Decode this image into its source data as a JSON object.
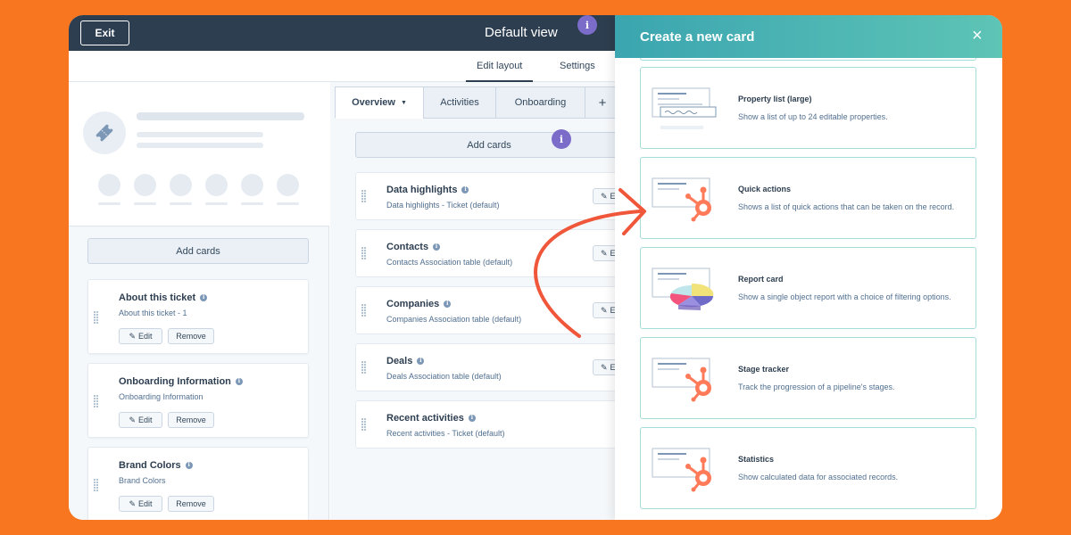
{
  "topbar": {
    "exit_label": "Exit",
    "title": "Default view",
    "info_glyph": "i"
  },
  "subtabs": {
    "edit_layout": "Edit layout",
    "settings": "Settings"
  },
  "left": {
    "add_cards_label": "Add cards",
    "cards": [
      {
        "title": "About this ticket",
        "subtitle": "About this ticket - 1",
        "edit": "Edit",
        "remove": "Remove"
      },
      {
        "title": "Onboarding Information",
        "subtitle": "Onboarding Information",
        "edit": "Edit",
        "remove": "Remove"
      },
      {
        "title": "Brand Colors",
        "subtitle": "Brand Colors",
        "edit": "Edit",
        "remove": "Remove"
      }
    ]
  },
  "middle": {
    "tabs": [
      {
        "label": "Overview"
      },
      {
        "label": "Activities"
      },
      {
        "label": "Onboarding"
      },
      {
        "label": "+"
      }
    ],
    "add_cards_label": "Add cards",
    "cards": [
      {
        "title": "Data highlights",
        "subtitle": "Data highlights - Ticket (default)"
      },
      {
        "title": "Contacts",
        "subtitle": "Contacts Association table (default)"
      },
      {
        "title": "Companies",
        "subtitle": "Companies Association table (default)"
      },
      {
        "title": "Deals",
        "subtitle": "Deals Association table (default)"
      },
      {
        "title": "Recent activities",
        "subtitle": "Recent activities - Ticket (default)"
      }
    ],
    "edit_partial": "E"
  },
  "drawer": {
    "title": "Create a new card",
    "close_glyph": "×",
    "cards": [
      {
        "title": "Property list (large)",
        "desc": "Show a list of up to 24 editable properties.",
        "illustration": "property-list"
      },
      {
        "title": "Quick actions",
        "desc": "Shows a list of quick actions that can be taken on the record.",
        "illustration": "hubspot-sprocket"
      },
      {
        "title": "Report card",
        "desc": "Show a single object report with a choice of filtering options.",
        "illustration": "pie-chart"
      },
      {
        "title": "Stage tracker",
        "desc": "Track the progression of a pipeline's stages.",
        "illustration": "hubspot-sprocket"
      },
      {
        "title": "Statistics",
        "desc": "Show calculated data for associated records.",
        "illustration": "hubspot-sprocket"
      }
    ]
  },
  "colors": {
    "background": "#f7761f",
    "topbar": "#2d3e50",
    "drawer_gradient_start": "#3ba5b0",
    "drawer_gradient_end": "#5ec4b6",
    "accent_orange": "#ff7a59",
    "arrow": "#f0563a",
    "info_badge": "#7c6cc9"
  }
}
